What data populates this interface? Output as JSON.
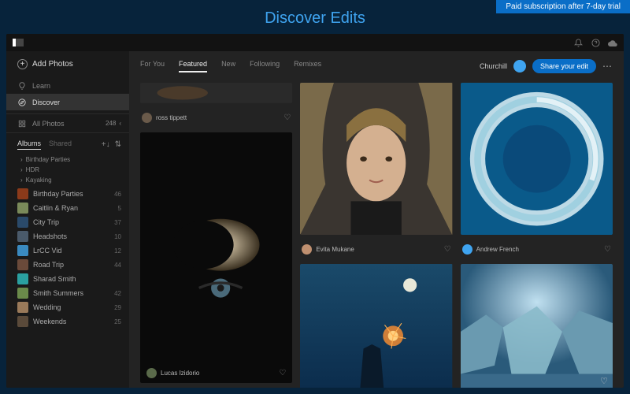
{
  "banner": "Paid subscription after 7-day trial",
  "page_title": "Discover Edits",
  "titlebar": {
    "icons": [
      "bell",
      "help",
      "cloud"
    ]
  },
  "sidebar": {
    "add_photos": "Add Photos",
    "nav": [
      {
        "icon": "lightbulb",
        "label": "Learn",
        "active": false
      },
      {
        "icon": "compass",
        "label": "Discover",
        "active": true
      }
    ],
    "all_photos": {
      "label": "All Photos",
      "count": "248"
    },
    "tab_albums": "Albums",
    "tab_shared": "Shared",
    "folders": [
      {
        "label": "Birthday Parties"
      },
      {
        "label": "HDR"
      },
      {
        "label": "Kayaking"
      }
    ],
    "albums": [
      {
        "name": "Birthday Parties",
        "count": "46",
        "color": "#8b3a1a"
      },
      {
        "name": "Caitlin & Ryan",
        "count": "5",
        "color": "#7a8a5a"
      },
      {
        "name": "City Trip",
        "count": "37",
        "color": "#2a4a6a"
      },
      {
        "name": "Headshots",
        "count": "10",
        "color": "#4a5a6a"
      },
      {
        "name": "LrCC Vid",
        "count": "12",
        "color": "#3a8ac0"
      },
      {
        "name": "Road Trip",
        "count": "44",
        "color": "#6a4a3a"
      },
      {
        "name": "Sharad Smith",
        "count": "",
        "color": "#2aa0a0"
      },
      {
        "name": "Smith Summers",
        "count": "42",
        "color": "#6a8a4a"
      },
      {
        "name": "Wedding",
        "count": "29",
        "color": "#9a7a5a"
      },
      {
        "name": "Weekends",
        "count": "25",
        "color": "#5a4a3a"
      }
    ]
  },
  "content": {
    "filter_tabs": [
      "For You",
      "Featured",
      "New",
      "Following",
      "Remixes"
    ],
    "active_tab": 1,
    "user": "Churchill",
    "share_button": "Share your edit",
    "gallery": {
      "col1": {
        "top_author": "ross tippett",
        "bottom_author": "Lucas Izidorio"
      },
      "col2": {
        "top_author": "Evita Mukane"
      },
      "col3": {
        "author": "Andrew French"
      }
    }
  }
}
